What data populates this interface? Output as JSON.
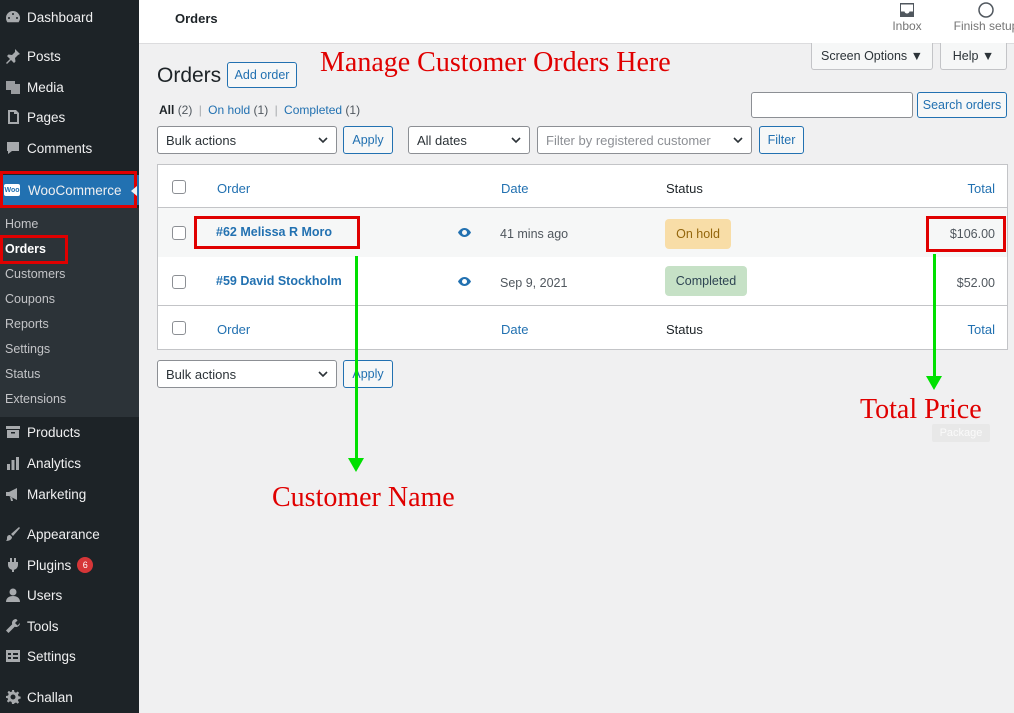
{
  "sidebar": {
    "items_top": [
      {
        "label": "Dashboard",
        "icon": "dashboard-icon"
      },
      {
        "label": "Posts",
        "icon": "pin-icon"
      },
      {
        "label": "Media",
        "icon": "media-icon"
      },
      {
        "label": "Pages",
        "icon": "pages-icon"
      },
      {
        "label": "Comments",
        "icon": "comment-icon"
      }
    ],
    "woocommerce_label": "WooCommerce",
    "woocommerce_logo_text": "Woo",
    "submenu": [
      "Home",
      "Orders",
      "Customers",
      "Coupons",
      "Reports",
      "Settings",
      "Status",
      "Extensions"
    ],
    "items_bottom": [
      {
        "label": "Products",
        "icon": "archive-icon"
      },
      {
        "label": "Analytics",
        "icon": "bar-chart-icon"
      },
      {
        "label": "Marketing",
        "icon": "megaphone-icon"
      },
      {
        "label": "Appearance",
        "icon": "brush-icon"
      },
      {
        "label": "Plugins",
        "icon": "plugin-icon",
        "badge": "6"
      },
      {
        "label": "Users",
        "icon": "user-icon"
      },
      {
        "label": "Tools",
        "icon": "wrench-icon"
      },
      {
        "label": "Settings",
        "icon": "settings-icon"
      },
      {
        "label": "Challan",
        "icon": "gear-icon"
      }
    ]
  },
  "topbar": {
    "title": "Orders",
    "inbox_label": "Inbox",
    "finish_setup_label": "Finish setup"
  },
  "header": {
    "screen_options": "Screen Options ▼",
    "help": "Help ▼",
    "page_title": "Orders",
    "add_order": "Add order"
  },
  "filters": {
    "all_label": "All",
    "all_count": "(2)",
    "on_hold_label": "On hold",
    "on_hold_count": "(1)",
    "completed_label": "Completed",
    "completed_count": "(1)",
    "separator": "|",
    "search_button": "Search orders",
    "bulk_actions": "Bulk actions",
    "apply": "Apply",
    "all_dates": "All dates",
    "customer_placeholder": "Filter by registered customer",
    "filter_button": "Filter"
  },
  "table": {
    "columns": {
      "order": "Order",
      "date": "Date",
      "status": "Status",
      "total": "Total"
    },
    "rows": [
      {
        "order": "#62 Melissa R Moro",
        "date": "41 mins ago",
        "status": "On hold",
        "total": "$106.00",
        "status_bg": "#f8dda7",
        "status_color": "#94660c"
      },
      {
        "order": "#59 David Stockholm",
        "date": "Sep 9, 2021",
        "status": "Completed",
        "total": "$52.00",
        "status_bg": "#c6e1c6",
        "status_color": "#2e4453"
      }
    ]
  },
  "bottom_actions": {
    "bulk_actions": "Bulk actions",
    "apply": "Apply"
  },
  "faded_button": "Package",
  "annotations": {
    "top": "Manage Customer Orders Here",
    "customer": "Customer Name",
    "price": "Total Price"
  }
}
